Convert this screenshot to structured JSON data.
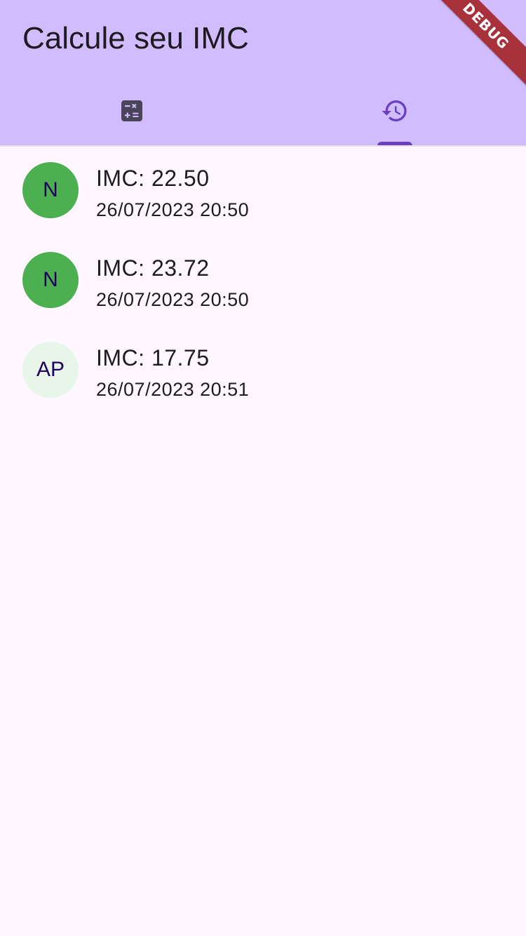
{
  "appbar": {
    "title": "Calcule seu IMC",
    "background": "#D1BCFF"
  },
  "tabs": [
    {
      "icon": "calculator-icon",
      "selected": false,
      "color": "#4A4458"
    },
    {
      "icon": "history-icon",
      "selected": true,
      "color": "#6A3FC2"
    }
  ],
  "history": {
    "items": [
      {
        "avatar_text": "N",
        "avatar_color": "#4CAF50",
        "title": "IMC: 22.50",
        "subtitle": "26/07/2023 20:50"
      },
      {
        "avatar_text": "N",
        "avatar_color": "#4CAF50",
        "title": "IMC: 23.72",
        "subtitle": "26/07/2023 20:50"
      },
      {
        "avatar_text": "AP",
        "avatar_color": "#E8F5E9",
        "title": "IMC: 17.75",
        "subtitle": "26/07/2023 20:51"
      }
    ]
  },
  "debug_banner": {
    "label": "DEBUG",
    "color": "#A8323B"
  }
}
